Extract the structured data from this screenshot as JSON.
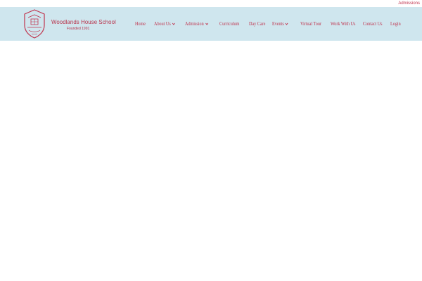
{
  "topbar": {
    "admissions_link": "Admissions"
  },
  "brand": {
    "name": "Woodlands House School",
    "tagline": "Founded 1991",
    "crest_icon": "school-crest-icon"
  },
  "nav": {
    "items": [
      {
        "label": "Home",
        "dropdown": false
      },
      {
        "label": "About Us",
        "dropdown": true
      },
      {
        "label": "Admission",
        "dropdown": true
      },
      {
        "label": "Curriculum",
        "dropdown": false
      },
      {
        "label": "Day Care",
        "dropdown": false
      },
      {
        "label": "Events",
        "dropdown": true
      },
      {
        "label": "Virtual Tour",
        "dropdown": false
      },
      {
        "label": "Work With Us",
        "dropdown": false
      },
      {
        "label": "Contact Us",
        "dropdown": false
      },
      {
        "label": "Login",
        "dropdown": false
      }
    ]
  },
  "colors": {
    "accent": "#c0334d",
    "header_bg": "#cfe6ee",
    "page_bg": "#ffffff"
  }
}
